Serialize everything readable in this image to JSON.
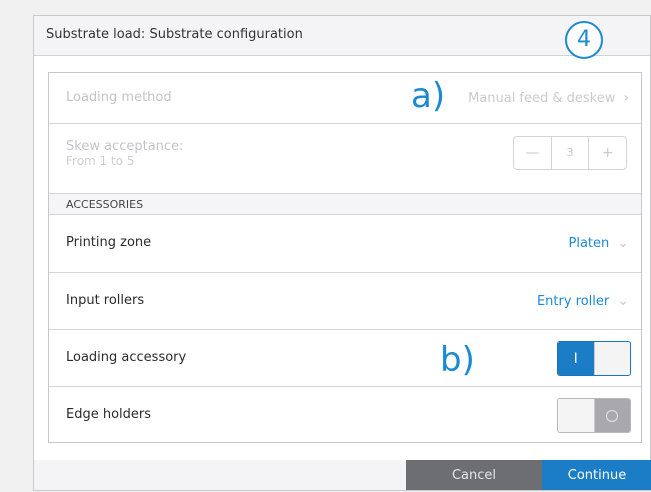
{
  "dialog": {
    "title": "Substrate load: Substrate configuration",
    "step_badge": "4"
  },
  "annotations": {
    "a": "a)",
    "b": "b)"
  },
  "rows": {
    "loading_method": {
      "label": "Loading method",
      "value": "Manual feed & deskew",
      "icon": "chevron-right-icon"
    },
    "skew_acceptance": {
      "label": "Skew acceptance:",
      "sublabel": "From 1 to 5",
      "value": "3",
      "minus": "—",
      "plus": "+"
    },
    "accessories_header": "ACCESSORIES",
    "printing_zone": {
      "label": "Printing zone",
      "value": "Platen",
      "icon": "chevron-down-icon"
    },
    "input_rollers": {
      "label": "Input rollers",
      "value": "Entry roller",
      "icon": "chevron-down-icon"
    },
    "loading_accessory": {
      "label": "Loading accessory",
      "state": "on",
      "on_glyph": "I"
    },
    "edge_holders": {
      "label": "Edge holders",
      "state": "off"
    }
  },
  "footer": {
    "cancel_label": "Cancel",
    "continue_label": "Continue"
  },
  "colors": {
    "accent": "#1b8ad3",
    "button_primary": "#1b7dc6",
    "button_secondary": "#6d6e71"
  }
}
